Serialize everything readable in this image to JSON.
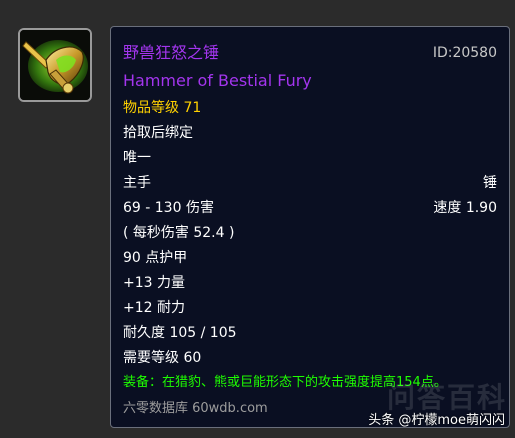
{
  "item": {
    "icon": "hammer-icon",
    "name_cn": "野兽狂怒之锤",
    "name_en": "Hammer of Bestial Fury",
    "id_label": "ID:20580",
    "item_level": "物品等级 71",
    "bind": "拾取后绑定",
    "unique": "唯一",
    "slot": "主手",
    "type": "锤",
    "damage": "69 - 130 伤害",
    "speed": "速度 1.90",
    "dps": "( 每秒伤害 52.4 )",
    "armor": "90 点护甲",
    "strength": "+13 力量",
    "stamina": "+12 耐力",
    "durability": "耐久度 105 / 105",
    "required_level": "需要等级 60",
    "equip_effect": "装备：在猎豹、熊或巨能形态下的攻击强度提高154点。"
  },
  "footer": {
    "source": "六零数据库 60wdb.com"
  },
  "watermark": {
    "text": "头条 @柠檬moe萌闪闪",
    "background_text": "问答百科"
  },
  "colors": {
    "epic": "#a335ee",
    "item_level": "#ffd100",
    "equip": "#1eff00",
    "footer": "#9d9d9d",
    "tooltip_bg": "#0a0f22"
  }
}
